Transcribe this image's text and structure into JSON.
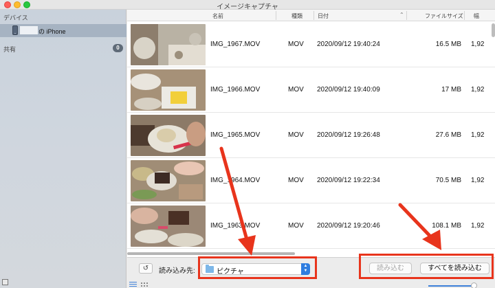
{
  "window": {
    "title": "イメージキャプチャ"
  },
  "sidebar": {
    "devices_header": "デバイス",
    "device_name": "の iPhone",
    "shared_header": "共有",
    "shared_count": "0"
  },
  "columns": {
    "name": "名前",
    "type": "種類",
    "date": "日付",
    "size": "ファイルサイズ",
    "width": "幅"
  },
  "files": [
    {
      "name": "IMG_1967.MOV",
      "type": "MOV",
      "date": "2020/09/12 19:40:24",
      "size": "16.5 MB",
      "width": "1,92"
    },
    {
      "name": "IMG_1966.MOV",
      "type": "MOV",
      "date": "2020/09/12 19:40:09",
      "size": "17 MB",
      "width": "1,92"
    },
    {
      "name": "IMG_1965.MOV",
      "type": "MOV",
      "date": "2020/09/12 19:26:48",
      "size": "27.6 MB",
      "width": "1,92"
    },
    {
      "name": "IMG_1964.MOV",
      "type": "MOV",
      "date": "2020/09/12 19:22:34",
      "size": "70.5 MB",
      "width": "1,92"
    },
    {
      "name": "IMG_1963.MOV",
      "type": "MOV",
      "date": "2020/09/12 19:20:46",
      "size": "108.1 MB",
      "width": "1,92"
    }
  ],
  "bottom": {
    "rotate_symbol": "↺",
    "import_to_label": "読み込み先:",
    "import_to_value": "ピクチャ",
    "import_button": "読み込む",
    "import_all_button": "すべてを読み込む"
  },
  "colors": {
    "annotation": "#e8341c",
    "accent": "#2f7de0",
    "selection": "#a6b3c2"
  },
  "icons": [
    "iphone-icon",
    "folder-icon",
    "rotate-icon",
    "list-view-icon",
    "grid-view-icon",
    "sort-arrow-icon"
  ]
}
